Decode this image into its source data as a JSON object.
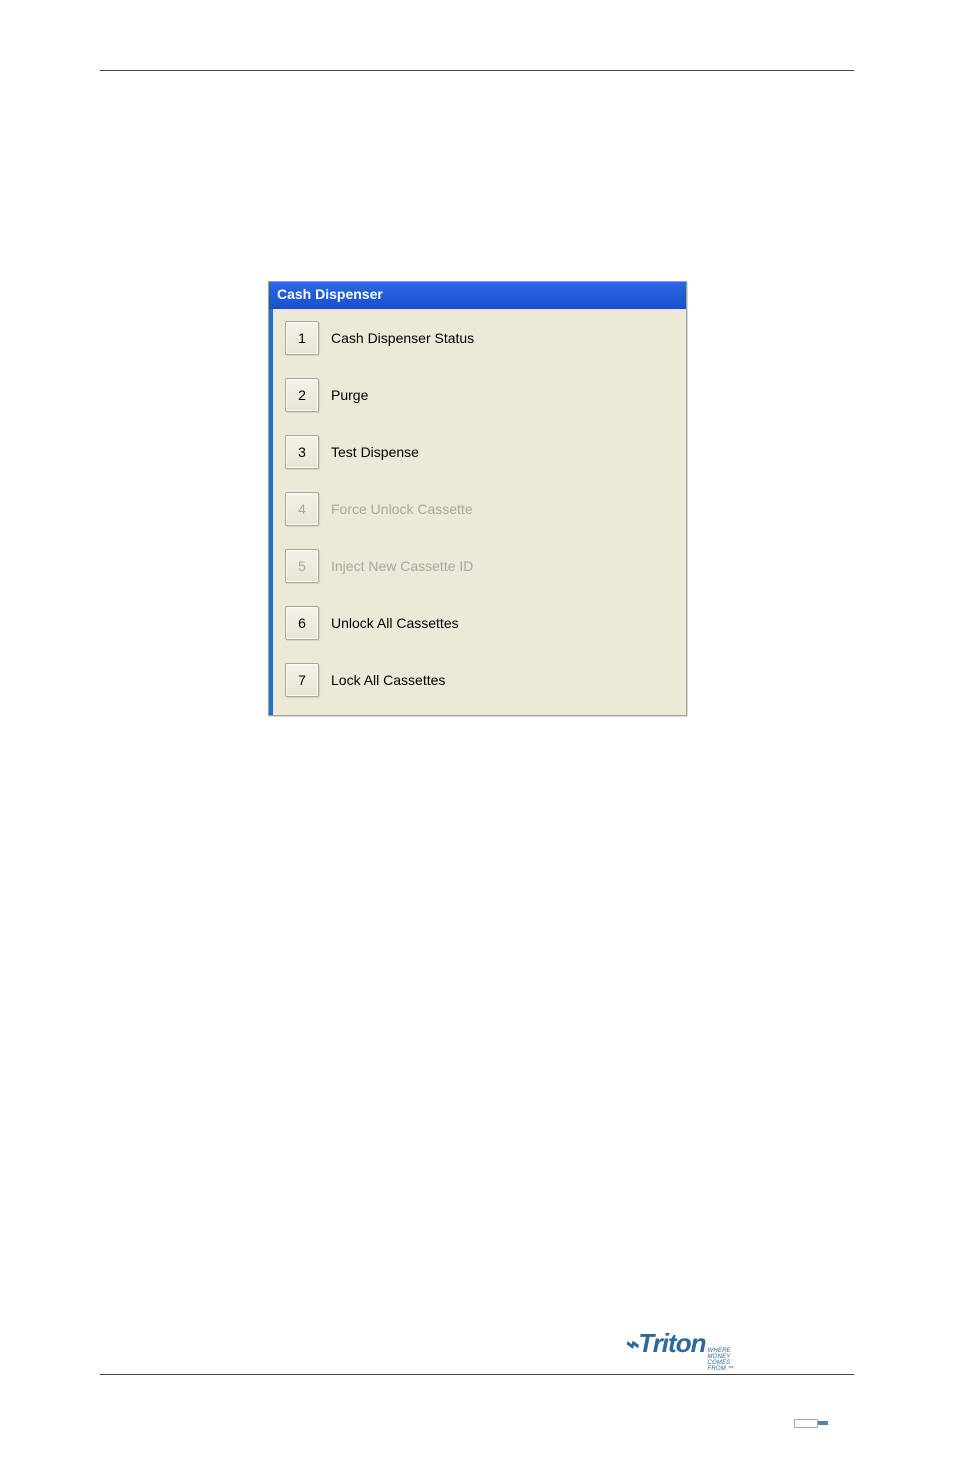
{
  "dialog": {
    "title": "Cash Dispenser",
    "items": [
      {
        "num": "1",
        "label": "Cash Dispenser Status",
        "enabled": true
      },
      {
        "num": "2",
        "label": "Purge",
        "enabled": true
      },
      {
        "num": "3",
        "label": "Test Dispense",
        "enabled": true
      },
      {
        "num": "4",
        "label": "Force Unlock Cassette",
        "enabled": false
      },
      {
        "num": "5",
        "label": "Inject New Cassette ID",
        "enabled": false
      },
      {
        "num": "6",
        "label": "Unlock All Cassettes",
        "enabled": true
      },
      {
        "num": "7",
        "label": "Lock All Cassettes",
        "enabled": true
      }
    ]
  },
  "footer": {
    "brand": "Triton",
    "tag": "WHERE MONEY COMES FROM.™"
  }
}
